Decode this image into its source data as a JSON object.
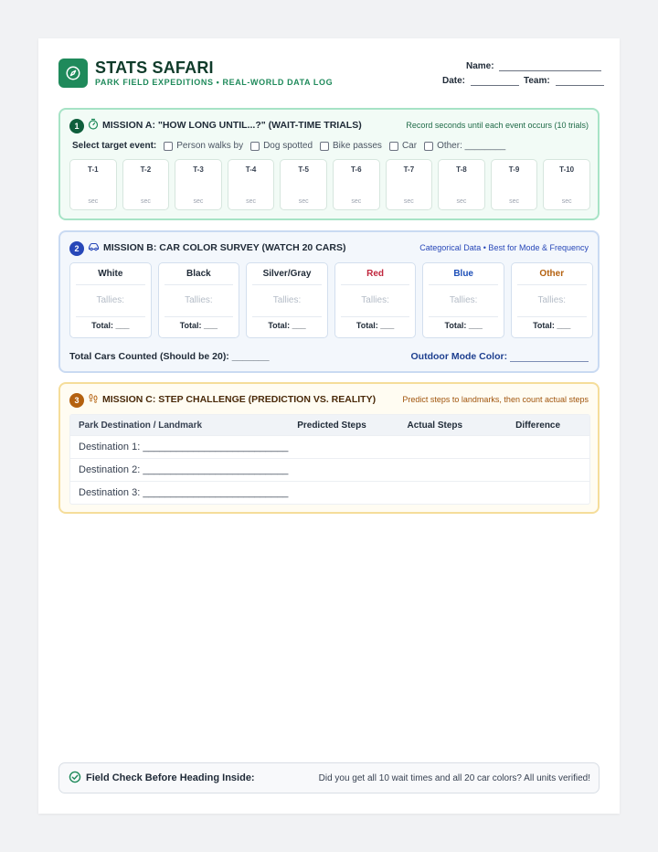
{
  "header": {
    "title": "STATS SAFARI",
    "subtitle": "PARK FIELD EXPEDITIONS • REAL-WORLD DATA LOG",
    "name_label": "Name:",
    "date_label": "Date:",
    "team_label": "Team:",
    "logo_icon": "compass-icon",
    "brand_color": "#1f8a5b"
  },
  "mission_a": {
    "number": "1",
    "icon": "stopwatch-icon",
    "title": "MISSION A: \"HOW LONG UNTIL...?\" (WAIT-TIME TRIALS)",
    "note": "Record seconds until each event occurs (10 trials)",
    "select_label": "Select target event:",
    "events": [
      "Person walks by",
      "Dog spotted",
      "Bike passes",
      "Car",
      "Other:"
    ],
    "other_blank": "________",
    "trials": [
      "T-1",
      "T-2",
      "T-3",
      "T-4",
      "T-5",
      "T-6",
      "T-7",
      "T-8",
      "T-9",
      "T-10"
    ],
    "unit": "sec",
    "color": "#1f8a5b"
  },
  "mission_b": {
    "number": "2",
    "icon": "car-icon",
    "title": "MISSION B: CAR COLOR SURVEY (WATCH 20 CARS)",
    "note": "Categorical Data • Best for Mode & Frequency",
    "colors": [
      {
        "name": "White",
        "color": "#1f2a37"
      },
      {
        "name": "Black",
        "color": "#1f2a37"
      },
      {
        "name": "Silver/Gray",
        "color": "#1f2a37"
      },
      {
        "name": "Red",
        "color": "#c0263d"
      },
      {
        "name": "Blue",
        "color": "#1d4fb8"
      },
      {
        "name": "Other",
        "color": "#b4610f"
      }
    ],
    "tallies_label": "Tallies:",
    "total_label": "Total: ___",
    "total_cars_label": "Total Cars Counted (Should be 20):",
    "total_cars_blank": "_______",
    "mode_label": "Outdoor Mode Color:",
    "color": "#2747b8"
  },
  "mission_c": {
    "number": "3",
    "icon": "footprints-icon",
    "title": "MISSION C: STEP CHALLENGE (PREDICTION VS. REALITY)",
    "note": "Predict steps to landmarks, then count actual steps",
    "columns": [
      "Park Destination / Landmark",
      "Predicted Steps",
      "Actual Steps",
      "Difference"
    ],
    "rows": [
      "Destination 1:",
      "Destination 2:",
      "Destination 3:"
    ],
    "row_blank": "__________________________",
    "color": "#b4610f"
  },
  "footer": {
    "icon": "check-circle-icon",
    "label": "Field Check Before Heading Inside:",
    "message": "Did you get all 10 wait times and all 20 car colors? All units verified!"
  }
}
